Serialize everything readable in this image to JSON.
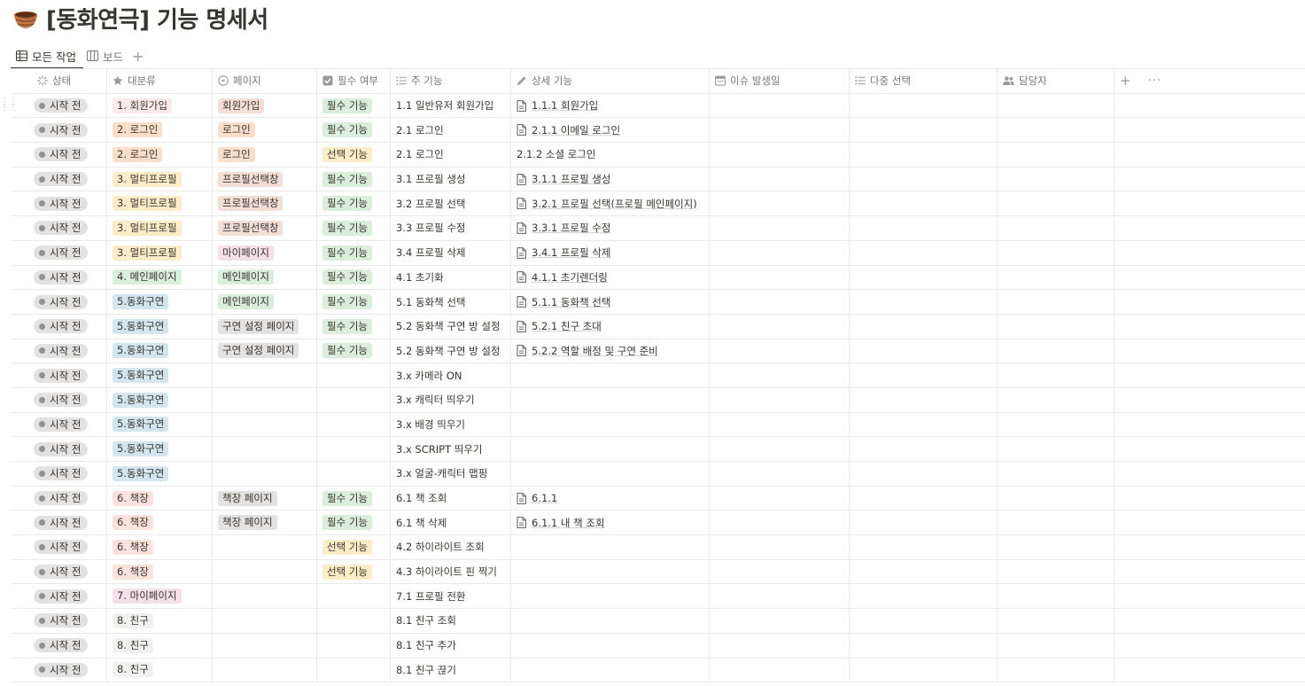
{
  "page": {
    "title": "[동화연극] 기능 명세서",
    "icon": "basket-icon"
  },
  "tabs": [
    {
      "label": "모든 작업",
      "icon": "table-icon",
      "active": true
    },
    {
      "label": "보드",
      "icon": "board-icon",
      "active": false
    }
  ],
  "columns": [
    {
      "label": "상태",
      "icon": "status-icon"
    },
    {
      "label": "대분류",
      "icon": "star-icon"
    },
    {
      "label": "페이지",
      "icon": "select-icon"
    },
    {
      "label": "필수 여부",
      "icon": "checkbox-icon"
    },
    {
      "label": "주 기능",
      "icon": "list-icon"
    },
    {
      "label": "상세 기능",
      "icon": "pencil-icon"
    },
    {
      "label": "이슈 발생일",
      "icon": "calendar-icon"
    },
    {
      "label": "다중 선택",
      "icon": "list-icon"
    },
    {
      "label": "담당자",
      "icon": "people-icon"
    }
  ],
  "colors": {
    "status_bg": "#e3e2e0",
    "category": {
      "1. 회원가입": "#fdebec",
      "2. 로그인": "#fadec9",
      "3. 멀티프로필": "#fdecc8",
      "4. 메인페이지": "#dbeddb",
      "5.동화구연": "#d3e5ef",
      "6. 책장": "#ffe2dd",
      "7. 마이페이지": "#f5e0e9",
      "8. 친구": "#f1f1ef"
    },
    "page": {
      "회원가입": "#f4dfd8",
      "로그인": "#fadec9",
      "프로필선택창": "#f4dfd8",
      "마이페이지": "#f5e0e9",
      "메인페이지": "#dbeddb",
      "구연 설정 페이지": "#e3e2e0",
      "책장 페이지": "#e3e2e0"
    },
    "required": {
      "필수 기능": "#dbeddb",
      "선택 기능": "#fdecc8"
    }
  },
  "rows": [
    {
      "status": "시작 전",
      "category": "1. 회원가입",
      "page": "회원가입",
      "required": "필수 기능",
      "main": "1.1 일반유저 회원가입",
      "detail": "1.1.1 회원가입",
      "doc": true
    },
    {
      "status": "시작 전",
      "category": "2. 로그인",
      "page": "로그인",
      "required": "필수 기능",
      "main": "2.1 로그인",
      "detail": "2.1.1 이메일 로그인",
      "doc": true
    },
    {
      "status": "시작 전",
      "category": "2. 로그인",
      "page": "로그인",
      "required": "선택 기능",
      "main": "2.1 로그인",
      "detail": "2.1.2 소셜 로그인",
      "doc": false
    },
    {
      "status": "시작 전",
      "category": "3. 멀티프로필",
      "page": "프로필선택창",
      "required": "필수 기능",
      "main": "3.1 프로필 생성",
      "detail": "3.1.1 프로필 생성",
      "doc": true
    },
    {
      "status": "시작 전",
      "category": "3. 멀티프로필",
      "page": "프로필선택창",
      "required": "필수 기능",
      "main": "3.2 프로필 선택",
      "detail": "3.2.1 프로필 선택(프로필 메인페이지)",
      "doc": true
    },
    {
      "status": "시작 전",
      "category": "3. 멀티프로필",
      "page": "프로필선택창",
      "required": "필수 기능",
      "main": "3.3 프로필 수정",
      "detail": "3.3.1 프로필 수정",
      "doc": true
    },
    {
      "status": "시작 전",
      "category": "3. 멀티프로필",
      "page": "마이페이지",
      "required": "필수 기능",
      "main": "3.4 프로필 삭제",
      "detail": "3.4.1 프로필 삭제",
      "doc": true
    },
    {
      "status": "시작 전",
      "category": "4. 메인페이지",
      "page": "메인페이지",
      "required": "필수 기능",
      "main": "4.1 초기화",
      "detail": "4.1.1 초기렌더링",
      "doc": true
    },
    {
      "status": "시작 전",
      "category": "5.동화구연",
      "page": "메인페이지",
      "required": "필수 기능",
      "main": "5.1 동화책 선택",
      "detail": "5.1.1 동화책 선택",
      "doc": true
    },
    {
      "status": "시작 전",
      "category": "5.동화구연",
      "page": "구연 설정 페이지",
      "required": "필수 기능",
      "main": "5.2 동화책 구연 방 설정",
      "detail": "5.2.1 친구 초대",
      "doc": true
    },
    {
      "status": "시작 전",
      "category": "5.동화구연",
      "page": "구연 설정 페이지",
      "required": "필수 기능",
      "main": "5.2 동화책 구연 방 설정",
      "detail": "5.2.2 역할 배정 및 구연 준비",
      "doc": true
    },
    {
      "status": "시작 전",
      "category": "5.동화구연",
      "page": "",
      "required": "",
      "main": "3.x 카메라 ON",
      "detail": "",
      "doc": false
    },
    {
      "status": "시작 전",
      "category": "5.동화구연",
      "page": "",
      "required": "",
      "main": "3.x 캐릭터 띄우기",
      "detail": "",
      "doc": false
    },
    {
      "status": "시작 전",
      "category": "5.동화구연",
      "page": "",
      "required": "",
      "main": "3.x 배경 띄우기",
      "detail": "",
      "doc": false
    },
    {
      "status": "시작 전",
      "category": "5.동화구연",
      "page": "",
      "required": "",
      "main": "3.x SCRIPT 띄우기",
      "detail": "",
      "doc": false
    },
    {
      "status": "시작 전",
      "category": "5.동화구연",
      "page": "",
      "required": "",
      "main": "3.x 얼굴-캐릭터 맵핑",
      "detail": "",
      "doc": false
    },
    {
      "status": "시작 전",
      "category": "6. 책장",
      "page": "책장 페이지",
      "required": "필수 기능",
      "main": "6.1 책 조회",
      "detail": "6.1.1",
      "doc": true
    },
    {
      "status": "시작 전",
      "category": "6. 책장",
      "page": "책장 페이지",
      "required": "필수 기능",
      "main": "6.1 책 삭제",
      "detail": "6.1.1 내 책 조회",
      "doc": true
    },
    {
      "status": "시작 전",
      "category": "6. 책장",
      "page": "",
      "required": "선택 기능",
      "main": "4.2 하이라이트 조회",
      "detail": "",
      "doc": false
    },
    {
      "status": "시작 전",
      "category": "6. 책장",
      "page": "",
      "required": "선택 기능",
      "main": "4.3 하이라이트 핀 찍기",
      "detail": "",
      "doc": false
    },
    {
      "status": "시작 전",
      "category": "7. 마이페이지",
      "page": "",
      "required": "",
      "main": "7.1 프로필 전환",
      "detail": "",
      "doc": false
    },
    {
      "status": "시작 전",
      "category": "8. 친구",
      "page": "",
      "required": "",
      "main": "8.1 친구 조회",
      "detail": "",
      "doc": false
    },
    {
      "status": "시작 전",
      "category": "8. 친구",
      "page": "",
      "required": "",
      "main": "8.1 친구 추가",
      "detail": "",
      "doc": false
    },
    {
      "status": "시작 전",
      "category": "8. 친구",
      "page": "",
      "required": "",
      "main": "8.1 친구 끊기",
      "detail": "",
      "doc": false
    }
  ]
}
